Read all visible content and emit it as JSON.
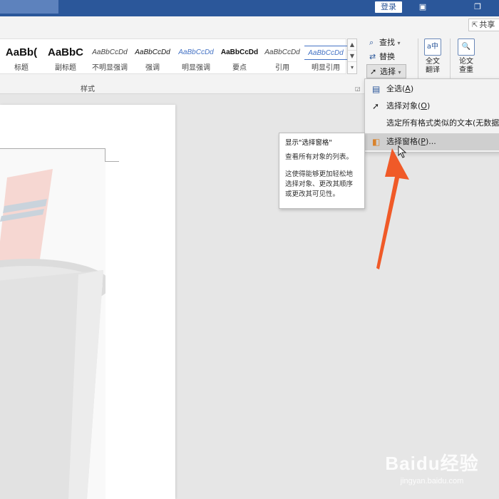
{
  "titlebar": {
    "login_label": "登录",
    "restore_icon": "restore-icon",
    "layout_icon": "ribbon-display-icon"
  },
  "share": {
    "label": "共享",
    "icon": "share-icon"
  },
  "styles": {
    "group_label": "样式",
    "items": [
      {
        "preview": "AaBb(",
        "label": "标题",
        "kind": "heading"
      },
      {
        "preview": "AaBbC",
        "label": "副标题",
        "kind": "heading"
      },
      {
        "preview": "AaBbCcDd",
        "label": "不明显强调",
        "kind": "italic"
      },
      {
        "preview": "AaBbCcDd",
        "label": "强调",
        "kind": "italic"
      },
      {
        "preview": "AaBbCcDd",
        "label": "明显强调",
        "kind": "blue"
      },
      {
        "preview": "AaBbCcDd",
        "label": "要点",
        "kind": "bold"
      },
      {
        "preview": "AaBbCcDd",
        "label": "引用",
        "kind": "italic"
      },
      {
        "preview": "AaBbCcDd",
        "label": "明显引用",
        "kind": "underline"
      }
    ]
  },
  "editing": {
    "find_label": "查找",
    "replace_label": "替换",
    "select_label": "选择"
  },
  "translate": {
    "label_line1": "全文",
    "label_line2": "翻译"
  },
  "paper_check": {
    "label_line1": "论文",
    "label_line2": "查重"
  },
  "select_menu": {
    "items": [
      {
        "label": "全选(",
        "key": "A",
        "tail": ")",
        "icon": "select-all-icon"
      },
      {
        "label": "选择对象(",
        "key": "O",
        "tail": ")",
        "icon": "select-objects-icon"
      },
      {
        "label": "选定所有格式类似的文本(无数据)(S",
        "key": "",
        "tail": "",
        "icon": ""
      },
      {
        "label": "选择窗格(",
        "key": "P",
        "tail": ")...",
        "icon": "selection-pane-icon"
      }
    ]
  },
  "tooltip": {
    "title": "显示\"选择窗格\"",
    "description": "查看所有对象的列表。",
    "detail": "这使得能够更加轻松地选择对象、更改其顺序或更改其可见性。"
  },
  "watermark": {
    "main": "Baidu经验",
    "sub": "jingyan.baidu.com"
  },
  "colors": {
    "titlebar": "#2b579a",
    "arrow": "#f05a28",
    "highlight": "#cfcfcf"
  }
}
